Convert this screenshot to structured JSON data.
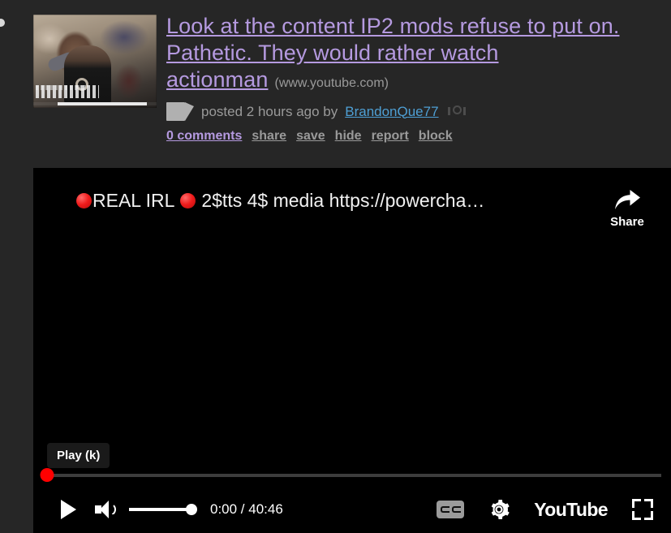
{
  "colors": {
    "page_background": "#262626",
    "title_link": "#b59ae0",
    "author_link": "#4e9fd4",
    "muted_text": "#9a9a9a",
    "player_background": "#000000",
    "progress_red": "#ff0000"
  },
  "post": {
    "title": "Look at the content IP2 mods refuse to put on. Pathetic. They would rather watch actionman",
    "domain": "(www.youtube.com)",
    "meta_posted": "posted 2 hours ago by",
    "author": "BrandonQue77",
    "links": {
      "comments": "0 comments",
      "share": "share",
      "save": "save",
      "hide": "hide",
      "report": "report",
      "block": "block"
    },
    "icons": {
      "media": "video-camera-icon",
      "award": "award-icon"
    }
  },
  "player": {
    "video_title": "REAL IRL  2$tts 4$ media https://powercha...",
    "video_title_prefix_emoji": "red-circle",
    "video_title_mid_emoji": "red-circle",
    "share_label": "Share",
    "tooltip": "Play (k)",
    "time_display": "0:00 / 40:46",
    "current_time": "0:00",
    "duration": "40:46",
    "progress_percent": 0,
    "volume_percent": 100,
    "youtube_logo": "YouTube",
    "controls": {
      "play": "play-button",
      "mute": "volume-button",
      "volume_slider": "volume-slider",
      "captions": "closed-captions-button",
      "settings": "settings-gear-button",
      "watch_on_youtube": "youtube-logo-button",
      "fullscreen": "fullscreen-button"
    }
  }
}
